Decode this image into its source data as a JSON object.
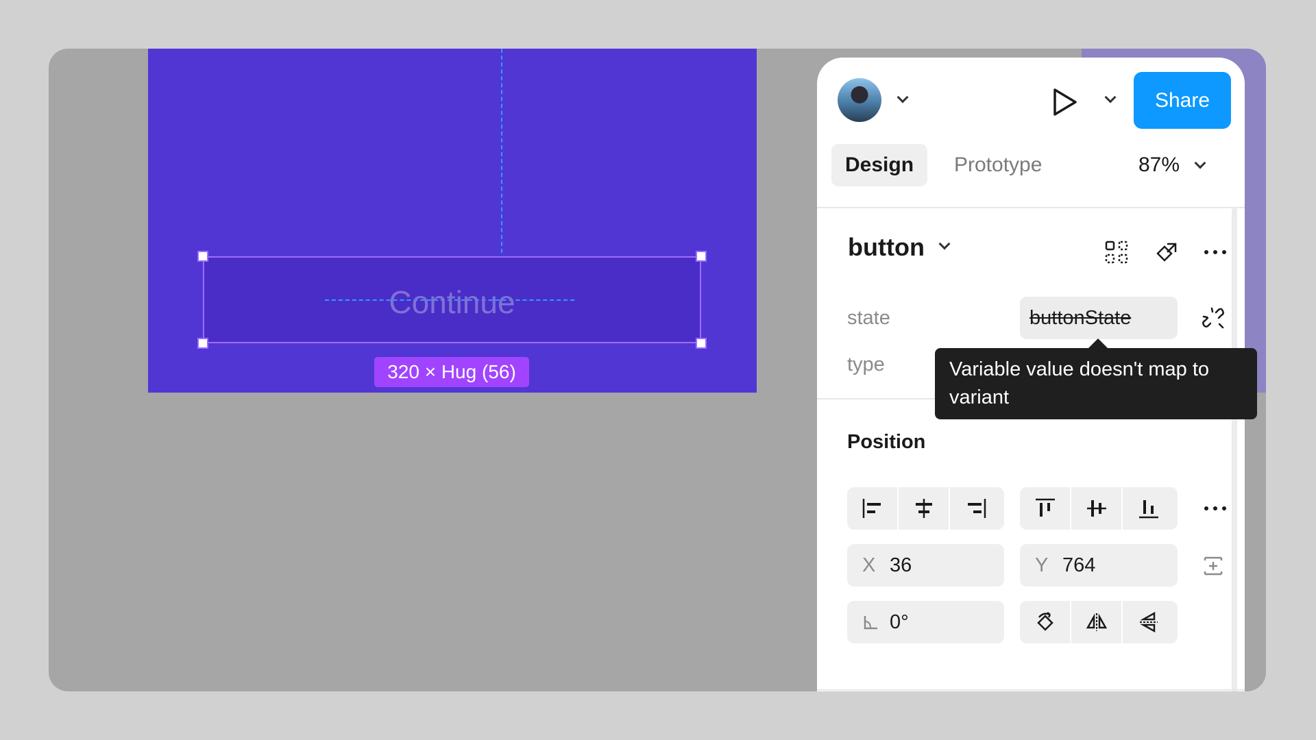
{
  "canvas": {
    "continue_text": "Continue",
    "size_badge": "320 × Hug (56)"
  },
  "header": {
    "share_label": "Share",
    "zoom": "87%"
  },
  "tabs": [
    {
      "label": "Design",
      "active": true
    },
    {
      "label": "Prototype",
      "active": false
    }
  ],
  "component": {
    "name": "button"
  },
  "properties": {
    "state_label": "state",
    "state_value": "buttonState",
    "type_label": "type"
  },
  "tooltip": {
    "text": "Variable value doesn't map to variant"
  },
  "position": {
    "title": "Position",
    "x_label": "X",
    "x_value": "36",
    "y_label": "Y",
    "y_value": "764",
    "rotation_value": "0°"
  },
  "colors": {
    "frame": "#5236d3",
    "selection": "#9c6cff",
    "share_button": "#0d99ff",
    "badge": "#a144ff"
  }
}
